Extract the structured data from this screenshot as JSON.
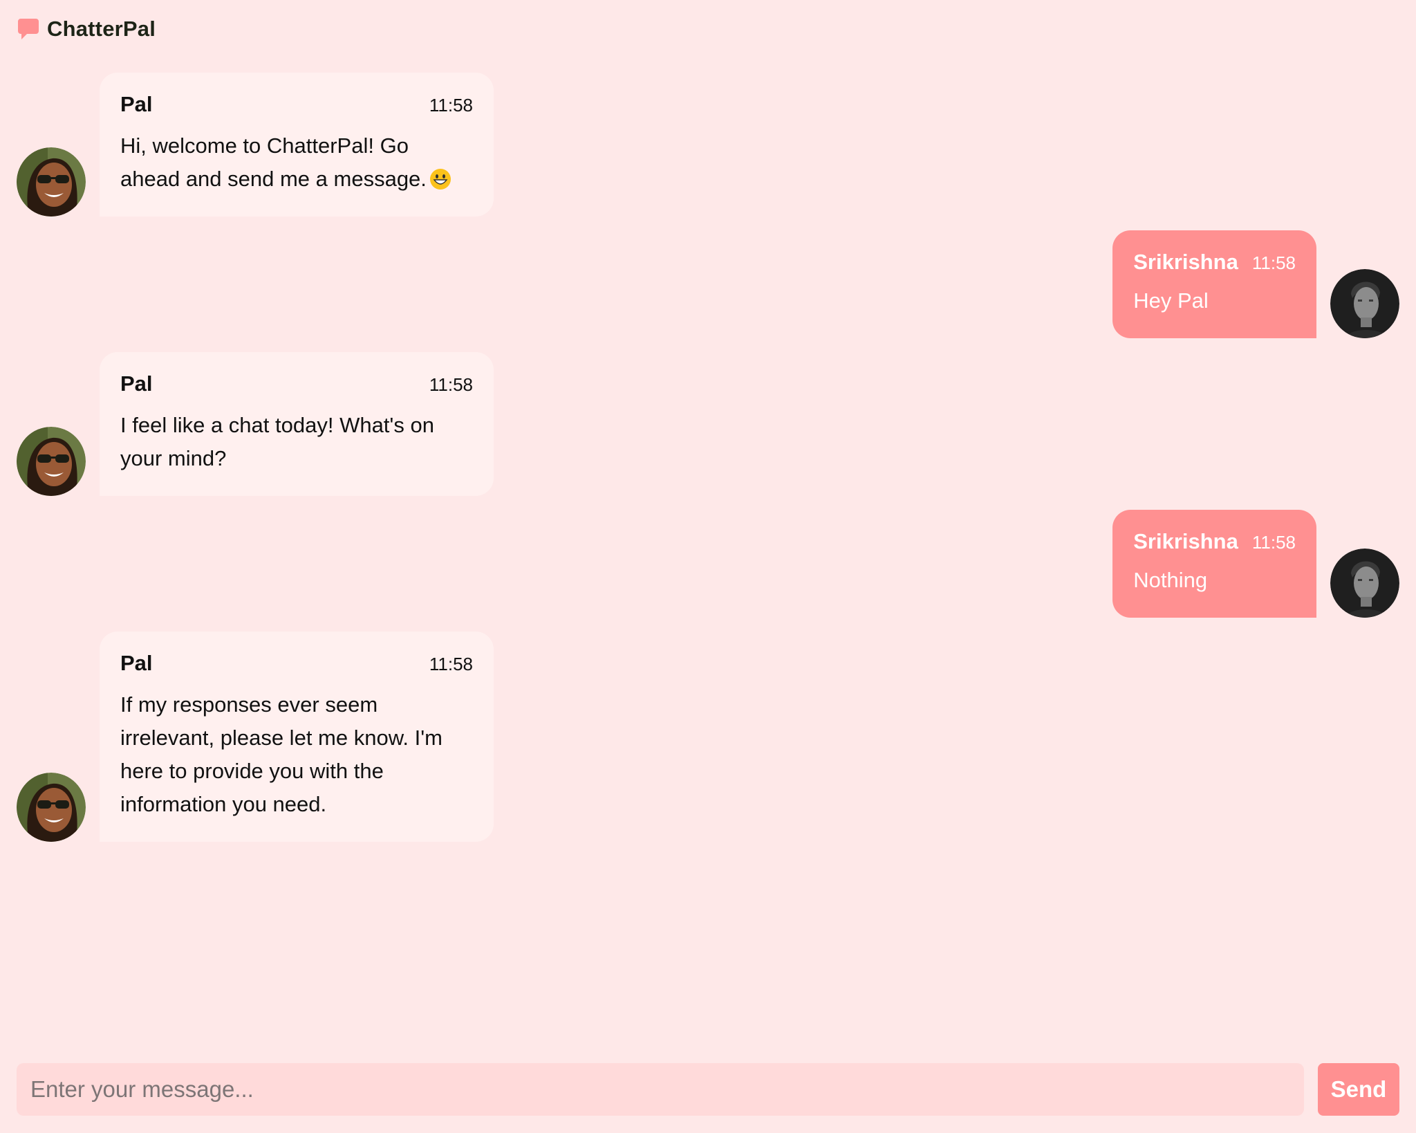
{
  "app": {
    "title": "ChatterPal",
    "icon": "chat-bubble-icon",
    "accent_color": "#ff9091",
    "background_color": "#fee8e8"
  },
  "messages": [
    {
      "sender": "Pal",
      "time": "11:58",
      "text": "Hi, welcome to ChatterPal! Go ahead and send me a message.",
      "emoji": "grinning-face-icon",
      "side": "left",
      "avatar": "bot-avatar"
    },
    {
      "sender": "Srikrishna",
      "time": "11:58",
      "text": "Hey Pal",
      "side": "right",
      "avatar": "user-avatar"
    },
    {
      "sender": "Pal",
      "time": "11:58",
      "text": "I feel like a chat today! What's on your mind?",
      "side": "left",
      "avatar": "bot-avatar"
    },
    {
      "sender": "Srikrishna",
      "time": "11:58",
      "text": "Nothing",
      "side": "right",
      "avatar": "user-avatar"
    },
    {
      "sender": "Pal",
      "time": "11:58",
      "text": "If my responses ever seem irrelevant, please let me know. I'm here to provide you with the information you need.",
      "side": "left",
      "avatar": "bot-avatar"
    }
  ],
  "composer": {
    "placeholder": "Enter your message...",
    "value": "",
    "send_label": "Send"
  }
}
